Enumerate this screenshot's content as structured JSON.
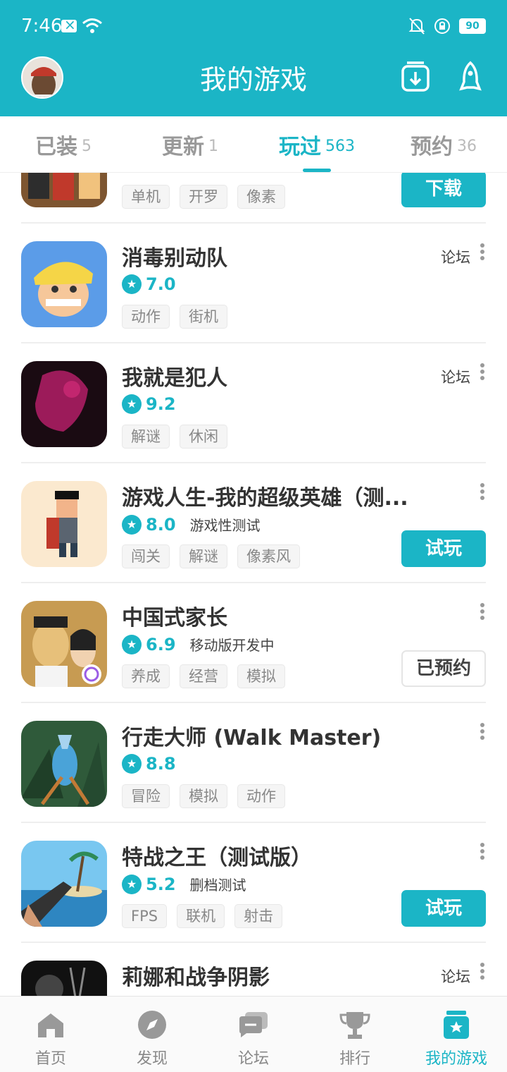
{
  "status_bar": {
    "time": "7:46",
    "battery": "90"
  },
  "header": {
    "title": "我的游戏"
  },
  "tabs": [
    {
      "label": "已装",
      "count": "5"
    },
    {
      "label": "更新",
      "count": "1"
    },
    {
      "label": "玩过",
      "count": "563",
      "active": true
    },
    {
      "label": "预约",
      "count": "36"
    }
  ],
  "games": [
    {
      "name": "",
      "tags": [
        "单机",
        "开罗",
        "像素"
      ],
      "button": "下载"
    },
    {
      "name": "消毒别动队",
      "score": "7.0",
      "tags": [
        "动作",
        "街机"
      ],
      "forum": "论坛"
    },
    {
      "name": "我就是犯人",
      "score": "9.2",
      "tags": [
        "解谜",
        "休闲"
      ],
      "forum": "论坛"
    },
    {
      "name": "游戏人生-我的超级英雄（测...",
      "score": "8.0",
      "note": "游戏性测试",
      "tags": [
        "闯关",
        "解谜",
        "像素风"
      ],
      "button": "试玩"
    },
    {
      "name": "中国式家长",
      "score": "6.9",
      "note": "移动版开发中",
      "tags": [
        "养成",
        "经营",
        "模拟"
      ],
      "button": "已预约"
    },
    {
      "name": "行走大师 (Walk Master)",
      "score": "8.8",
      "tags": [
        "冒险",
        "模拟",
        "动作"
      ]
    },
    {
      "name": "特战之王（测试版）",
      "score": "5.2",
      "note": "删档测试",
      "tags": [
        "FPS",
        "联机",
        "射击"
      ],
      "button": "试玩"
    },
    {
      "name": "莉娜和战争阴影",
      "forum": "论坛"
    }
  ],
  "bottom_nav": [
    {
      "label": "首页",
      "icon": "home-icon"
    },
    {
      "label": "发现",
      "icon": "compass-icon"
    },
    {
      "label": "论坛",
      "icon": "chat-icon"
    },
    {
      "label": "排行",
      "icon": "trophy-icon"
    },
    {
      "label": "我的游戏",
      "icon": "my-games-icon",
      "active": true
    }
  ],
  "colors": {
    "accent": "#1bb5c6"
  }
}
